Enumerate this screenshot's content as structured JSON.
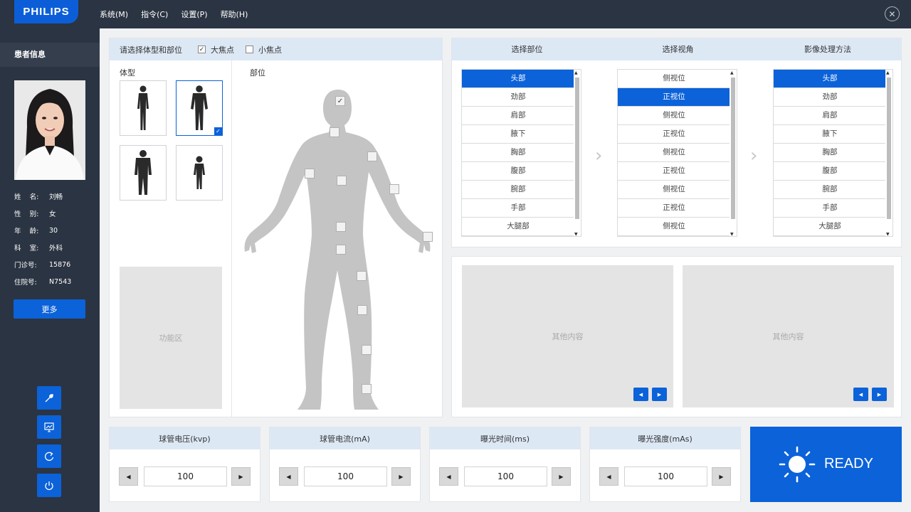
{
  "brand": "PHILIPS",
  "menu": [
    "系统(M)",
    "指令(C)",
    "设置(P)",
    "帮助(H)"
  ],
  "close_icon": "close-icon",
  "sidebar": {
    "title": "患者信息",
    "patient": [
      {
        "label": "姓    名:",
        "value": "刘畅"
      },
      {
        "label": "性    别:",
        "value": "女"
      },
      {
        "label": "年    龄:",
        "value": "30"
      },
      {
        "label": "科    室:",
        "value": "外科"
      },
      {
        "label": "门诊号:",
        "value": "15876"
      },
      {
        "label": "住院号:",
        "value": "N7543"
      }
    ],
    "more_label": "更多",
    "tools": [
      "wrench-icon",
      "monitor-icon",
      "refresh-icon",
      "power-icon"
    ]
  },
  "body_panel": {
    "title": "请选择体型和部位",
    "large_focus": "大焦点",
    "small_focus": "小焦点",
    "large_focus_checked": true,
    "small_focus_checked": false,
    "body_type_label": "体型",
    "part_label": "部位",
    "function_area": "功能区",
    "selected_body_type": 2
  },
  "selection": {
    "headers": [
      "选择部位",
      "选择视角",
      "影像处理方法"
    ],
    "parts": [
      "头部",
      "劲部",
      "肩部",
      "腋下",
      "胸部",
      "腹部",
      "腕部",
      "手部",
      "大腿部"
    ],
    "views": [
      "侧视位",
      "正视位",
      "侧视位",
      "正视位",
      "侧视位",
      "正视位",
      "侧视位",
      "正视位",
      "侧视位"
    ],
    "methods": [
      "头部",
      "劲部",
      "肩部",
      "腋下",
      "胸部",
      "腹部",
      "腕部",
      "手部",
      "大腿部"
    ],
    "parts_selected": 0,
    "views_selected": 1,
    "methods_selected": 0
  },
  "other_content": [
    "其他内容",
    "其他内容"
  ],
  "params": [
    {
      "label": "球管电压(kvp)",
      "value": "100"
    },
    {
      "label": "球管电流(mA)",
      "value": "100"
    },
    {
      "label": "曝光时间(ms)",
      "value": "100"
    },
    {
      "label": "曝光强度(mAs)",
      "value": "100"
    }
  ],
  "ready": {
    "label": "READY",
    "icon": "sun-icon"
  },
  "colors": {
    "accent": "#0b62d9",
    "topbar": "#2b3442",
    "header_bg": "#dde8f5"
  }
}
